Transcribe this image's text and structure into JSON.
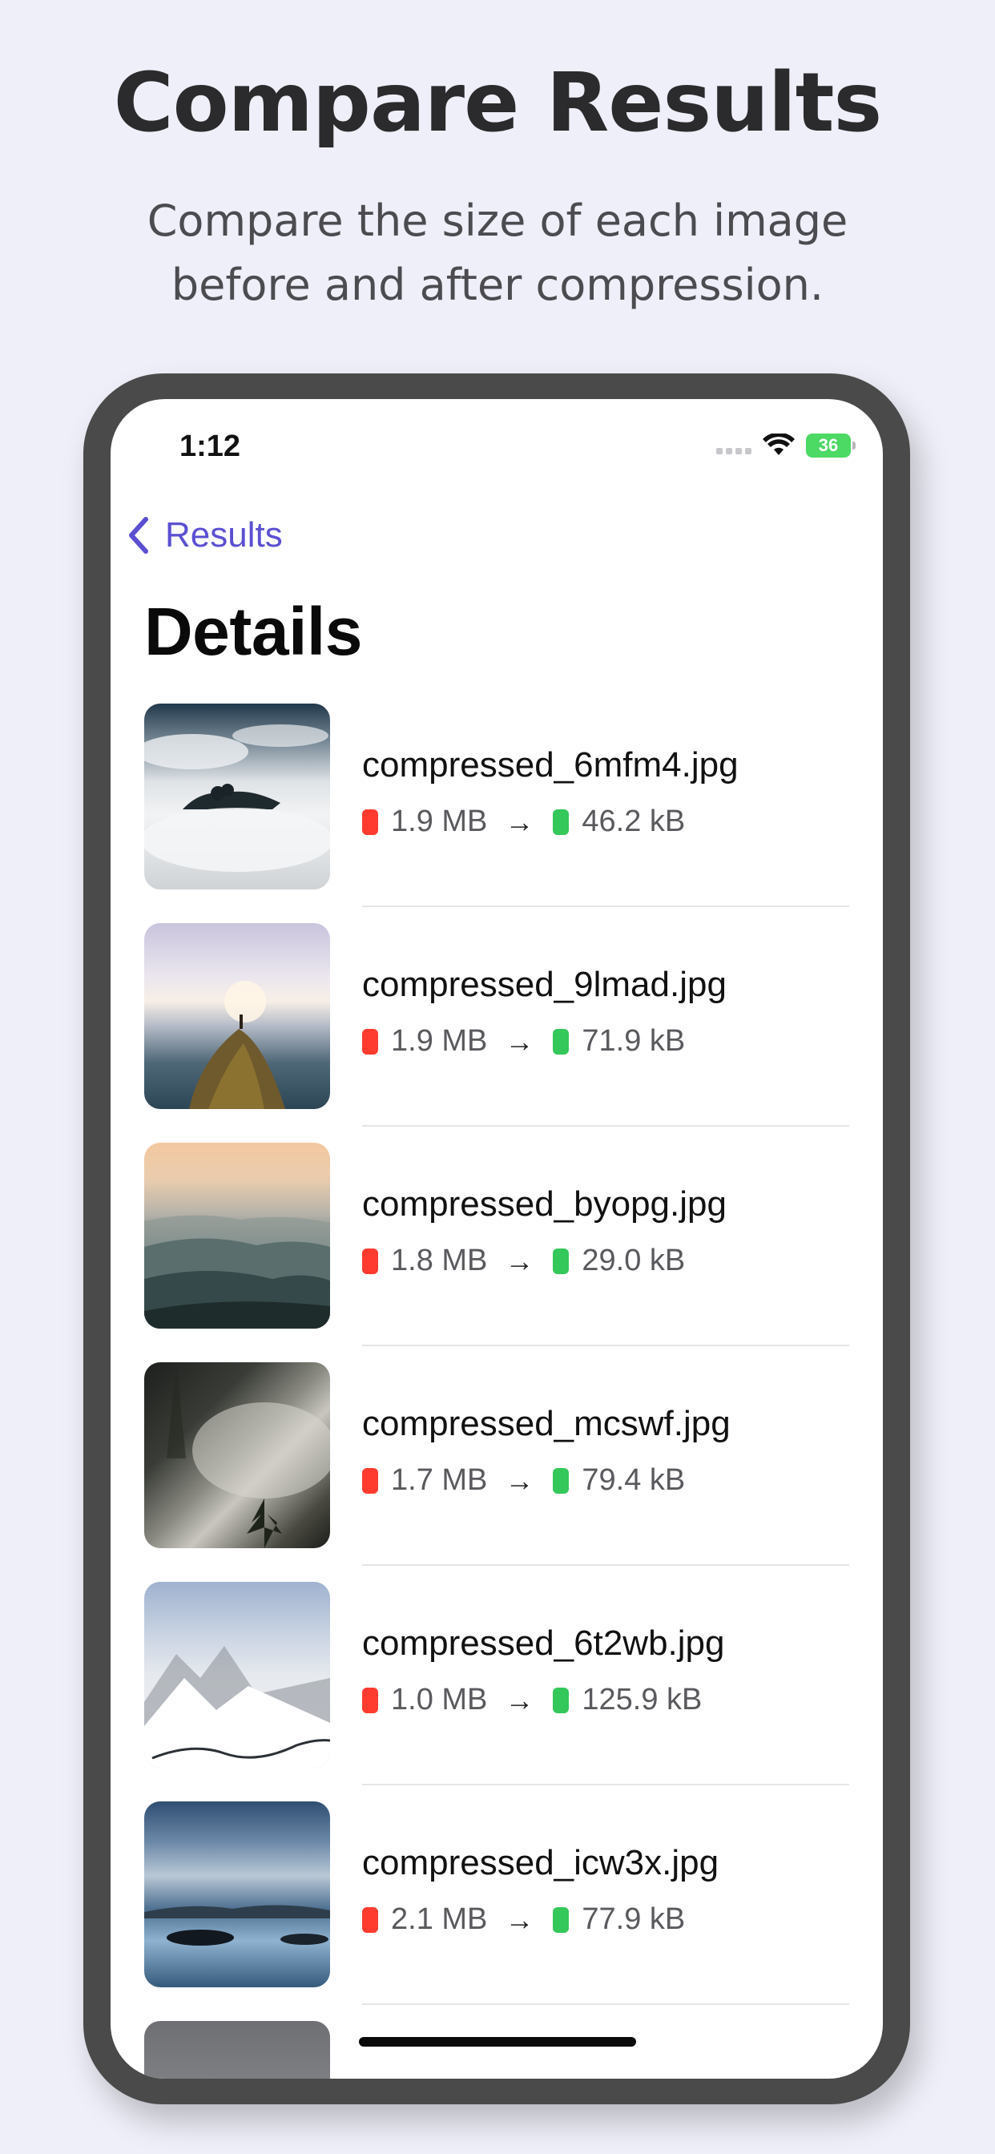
{
  "marketing": {
    "headline": "Compare Results",
    "subhead": "Compare the size of each image before and after compression."
  },
  "status_bar": {
    "time": "1:12",
    "battery": "36"
  },
  "nav": {
    "back_label": "Results",
    "title": "Details"
  },
  "colors": {
    "accent": "#5b4fd2",
    "original_dot": "#ff3b30",
    "compressed_dot": "#34c759",
    "background": "#efeff9"
  },
  "items": [
    {
      "name": "compressed_6mfm4.jpg",
      "original": "1.9 MB",
      "compressed": "46.2 kB"
    },
    {
      "name": "compressed_9lmad.jpg",
      "original": "1.9 MB",
      "compressed": "71.9 kB"
    },
    {
      "name": "compressed_byopg.jpg",
      "original": "1.8 MB",
      "compressed": "29.0 kB"
    },
    {
      "name": "compressed_mcswf.jpg",
      "original": "1.7 MB",
      "compressed": "79.4 kB"
    },
    {
      "name": "compressed_6t2wb.jpg",
      "original": "1.0 MB",
      "compressed": "125.9 kB"
    },
    {
      "name": "compressed_icw3x.jpg",
      "original": "2.1 MB",
      "compressed": "77.9 kB"
    }
  ]
}
